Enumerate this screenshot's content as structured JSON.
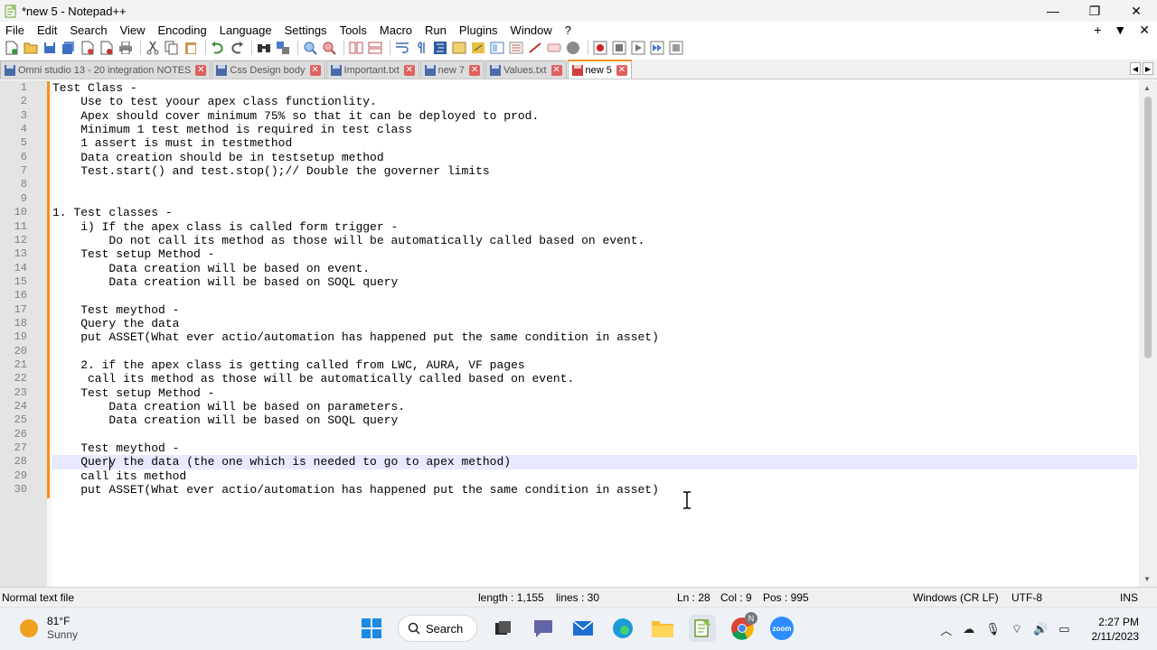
{
  "window": {
    "title": "*new 5 - Notepad++",
    "controls": {
      "minimize": "—",
      "maximize": "❐",
      "close": "✕"
    }
  },
  "menu": {
    "items": [
      "File",
      "Edit",
      "Search",
      "View",
      "Encoding",
      "Language",
      "Settings",
      "Tools",
      "Macro",
      "Run",
      "Plugins",
      "Window",
      "?"
    ],
    "right": {
      "add": "+",
      "dropdown": "▼",
      "close": "✕"
    }
  },
  "tabs": [
    {
      "label": "Omni studio 13 - 20 integration NOTES",
      "active": false
    },
    {
      "label": "Css Design body",
      "active": false
    },
    {
      "label": "Important.txt",
      "active": false
    },
    {
      "label": "new 7",
      "active": false
    },
    {
      "label": "Values.txt",
      "active": false
    },
    {
      "label": "new 5",
      "active": true
    }
  ],
  "editor": {
    "current_line": 28,
    "lines": [
      "Test Class -",
      "    Use to test yoour apex class functionlity.",
      "    Apex should cover minimum 75% so that it can be deployed to prod.",
      "    Minimum 1 test method is required in test class",
      "    1 assert is must in testmethod",
      "    Data creation should be in testsetup method",
      "    Test.start() and test.stop();// Double the governer limits",
      "",
      "",
      "1. Test classes -",
      "    i) If the apex class is called form trigger -",
      "        Do not call its method as those will be automatically called based on event.",
      "    Test setup Method -",
      "        Data creation will be based on event.",
      "        Data creation will be based on SOQL query",
      "",
      "    Test meythod -",
      "    Query the data",
      "    put ASSET(What ever actio/automation has happened put the same condition in asset)",
      "",
      "    2. if the apex class is getting called from LWC, AURA, VF pages",
      "     call its method as those will be automatically called based on event.",
      "    Test setup Method -",
      "        Data creation will be based on parameters.",
      "        Data creation will be based on SOQL query",
      "",
      "    Test meythod -",
      "    Query the data (the one which is needed to go to apex method)",
      "    call its method",
      "    put ASSET(What ever actio/automation has happened put the same condition in asset)"
    ]
  },
  "status": {
    "file_type": "Normal text file",
    "length": "length : 1,155",
    "lines": "lines : 30",
    "ln": "Ln : 28",
    "col": "Col : 9",
    "pos": "Pos : 995",
    "eol": "Windows (CR LF)",
    "encoding": "UTF-8",
    "mode": "INS"
  },
  "taskbar": {
    "weather_temp": "81°F",
    "weather_desc": "Sunny",
    "search_label": "Search",
    "time": "2:27 PM",
    "date": "2/11/2023",
    "chrome_badge": "N",
    "zoom_label": "zoom",
    "colors": {
      "accent": "#0067c0",
      "notepad_orange": "#fa8c1e"
    }
  }
}
